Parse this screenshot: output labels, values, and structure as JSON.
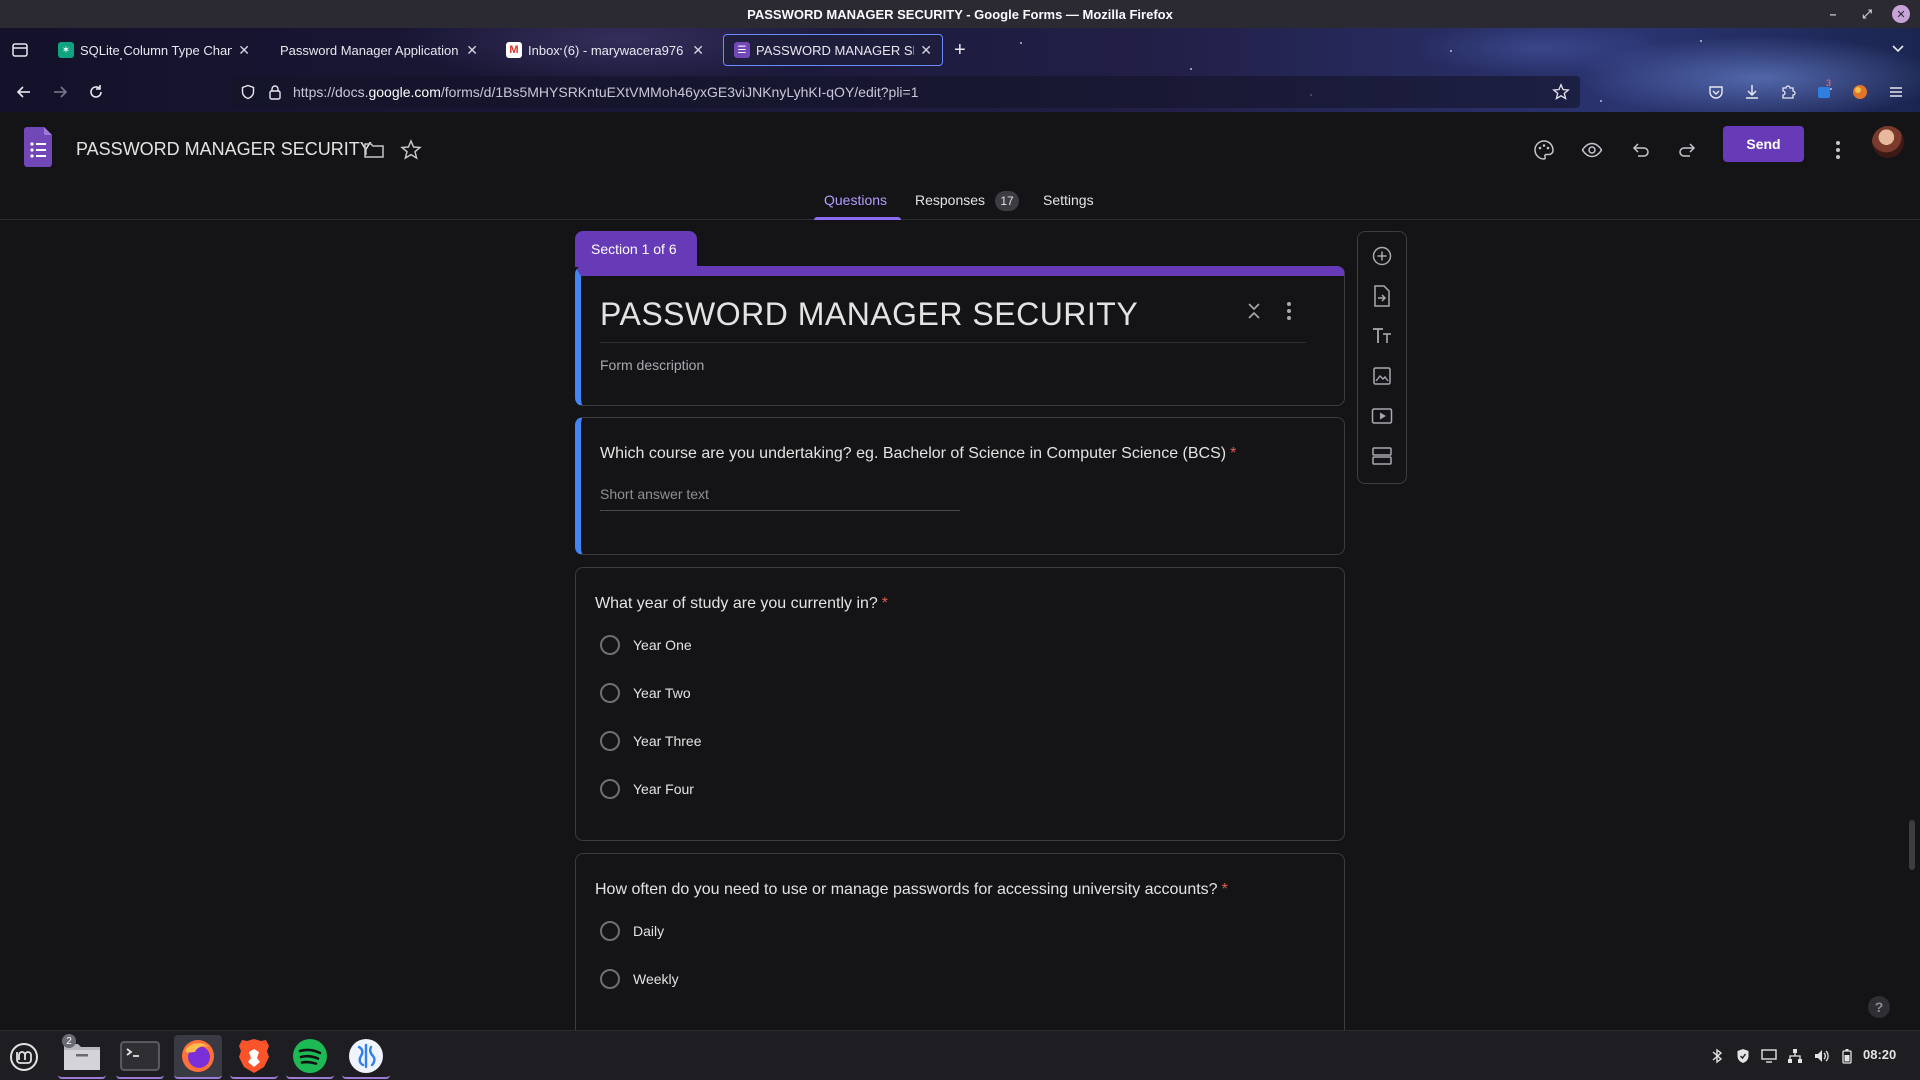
{
  "window": {
    "title": "PASSWORD MANAGER SECURITY - Google Forms — Mozilla Firefox"
  },
  "browser": {
    "tabs": [
      {
        "label": "SQLite Column Type Chang",
        "icon": "chatgpt-icon"
      },
      {
        "label": "Password Manager Application",
        "icon": "none"
      },
      {
        "label": "Inbox (6) - marywacera976",
        "icon": "gmail-icon"
      },
      {
        "label": "PASSWORD MANAGER SEC",
        "icon": "google-forms-icon",
        "active": true
      }
    ],
    "url_prefix": "https://docs.",
    "url_domain": "google.com",
    "url_path": "/forms/d/1Bs5MHYSRKntuEXtVMMoh46yxGE3viJNKnyLyhKI-qOY/edit?pli=1",
    "extension_badge": "3"
  },
  "forms": {
    "doc_title": "PASSWORD MANAGER SECURITY",
    "send_label": "Send",
    "tabs": {
      "questions": "Questions",
      "responses": "Responses",
      "responses_count": "17",
      "settings": "Settings"
    },
    "section_label": "Section 1 of 6",
    "form_title": "PASSWORD MANAGER SECURITY",
    "form_description": "Form description",
    "questions": [
      {
        "title": "Which course are you undertaking? eg. Bachelor of Science in Computer Science (BCS)",
        "required": "*",
        "type": "short",
        "placeholder": "Short answer text"
      },
      {
        "title": "What year of study are you currently in?",
        "required": "*",
        "type": "radio",
        "options": [
          "Year One",
          "Year Two",
          "Year Three",
          "Year Four"
        ]
      },
      {
        "title": "How often do you need to use or manage passwords for accessing university accounts?",
        "required": "*",
        "type": "radio",
        "options": [
          "Daily",
          "Weekly"
        ]
      }
    ],
    "help_label": "?"
  },
  "taskbar": {
    "files_badge": "2",
    "clock": "08:20"
  },
  "colors": {
    "accent": "#673ab7",
    "active_question": "#4285f4",
    "required": "#e85a4f"
  }
}
